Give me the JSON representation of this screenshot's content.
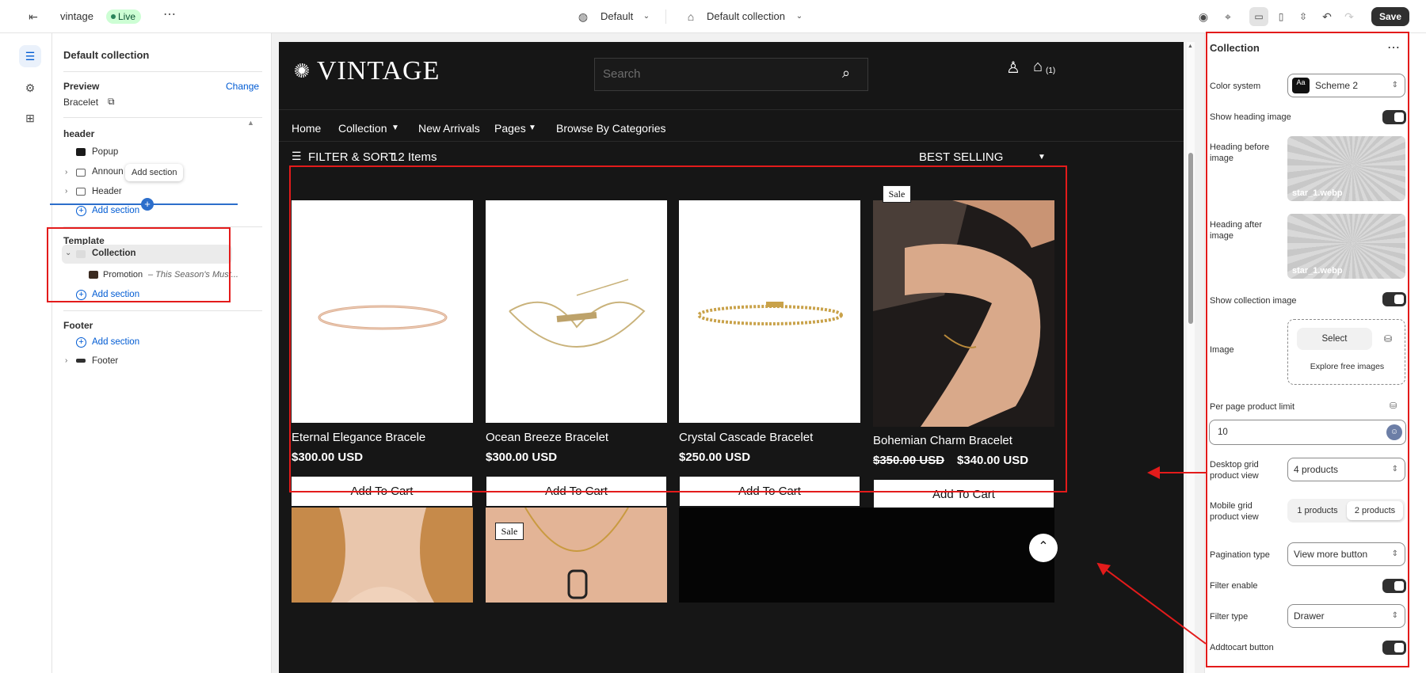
{
  "topbar": {
    "store_name": "vintage",
    "status": "Live",
    "theme_label": "Default",
    "template_label": "Default collection",
    "save_label": "Save"
  },
  "sidebar": {
    "title": "Default collection",
    "preview_label": "Preview",
    "change_label": "Change",
    "preview_value": "Bracelet",
    "header_group": "header",
    "header_items": [
      "Popup",
      "Announ",
      "Header"
    ],
    "tooltip": "Add section",
    "add_section": "Add section",
    "template_group": "Template",
    "template_items": [
      "Collection"
    ],
    "promotion_name": "Promotion",
    "promotion_sub": "– This Season's Must...",
    "footer_group": "Footer",
    "footer_items": [
      "Footer"
    ]
  },
  "storefront": {
    "logo": "VINTAGE",
    "search_placeholder": "Search",
    "cart_count": "(1)",
    "nav": [
      "Home",
      "Collection",
      "New Arrivals",
      "Pages",
      "Browse By Categories"
    ],
    "filter_label": "FILTER & SORT",
    "item_count": "12 Items",
    "sort_label": "BEST SELLING",
    "products": [
      {
        "title": "Eternal Elegance Bracele",
        "price": "$300.00 USD",
        "compare": "",
        "sale": false
      },
      {
        "title": "Ocean Breeze Bracelet",
        "price": "$300.00 USD",
        "compare": "",
        "sale": false
      },
      {
        "title": "Crystal Cascade Bracelet",
        "price": "$250.00 USD",
        "compare": "",
        "sale": false
      },
      {
        "title": "Bohemian Charm Bracelet",
        "price": "$340.00 USD",
        "compare": "$350.00 USD",
        "sale": true
      }
    ],
    "add_to_cart": "Add To Cart",
    "sale_label": "Sale"
  },
  "settings": {
    "title": "Collection",
    "color_system_label": "Color system",
    "color_system_value": "Scheme 2",
    "color_swatch_text": "Aa",
    "show_heading_image": "Show heading image",
    "heading_before_label": "Heading before image",
    "heading_after_label": "Heading after image",
    "image_file": "star_1.webp",
    "show_collection_image": "Show collection image",
    "image_label": "Image",
    "select_label": "Select",
    "explore_label": "Explore free images",
    "per_page_label": "Per page product limit",
    "per_page_value": "10",
    "desktop_grid_label": "Desktop grid product view",
    "desktop_grid_value": "4 products",
    "mobile_grid_label": "Mobile grid product view",
    "mobile_grid_options": [
      "1 products",
      "2 products"
    ],
    "pagination_label": "Pagination type",
    "pagination_value": "View more button",
    "filter_enable_label": "Filter enable",
    "filter_type_label": "Filter type",
    "filter_type_value": "Drawer",
    "addtocart_label": "Addtocart button"
  },
  "colors": {
    "accent": "#005bd3",
    "annotation_red": "#e31b1b",
    "storefront_bg": "#161616",
    "live_badge": "#cdfed4"
  }
}
